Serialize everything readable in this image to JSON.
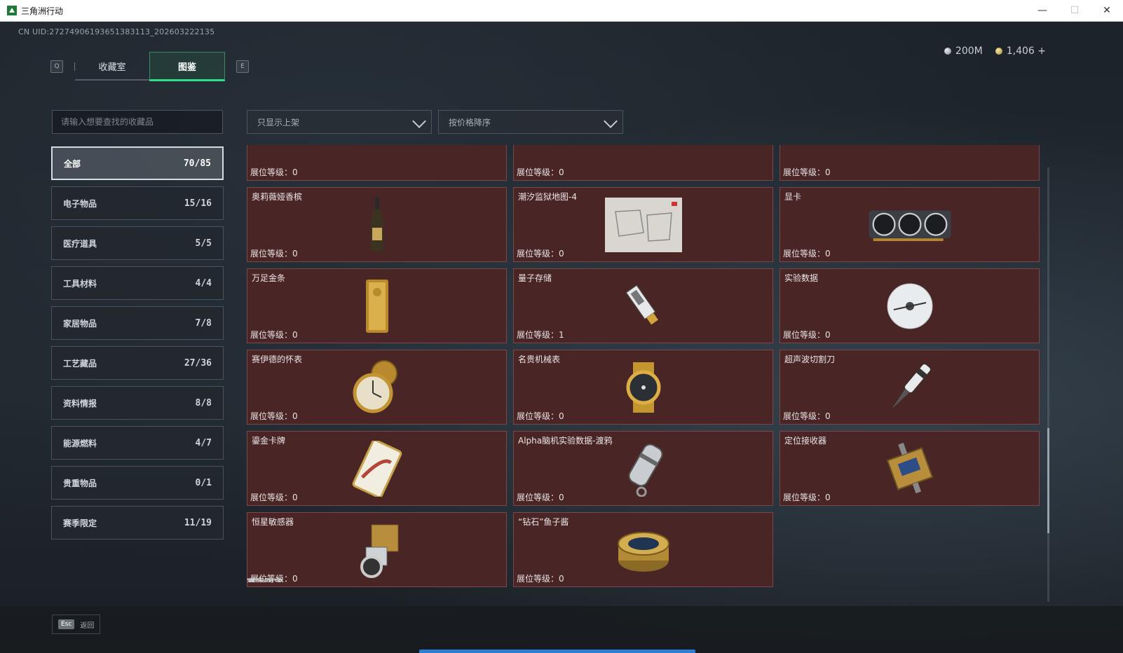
{
  "window": {
    "title": "三角洲行动",
    "minimize": "—",
    "maximize": "☐",
    "close": "✕"
  },
  "uid": "CN UID:2727490619365138311​3_202603222135",
  "tabs": {
    "left_key": "Q",
    "right_key": "E",
    "items": [
      {
        "label": "收藏室"
      },
      {
        "label": "图鉴"
      }
    ]
  },
  "currency": {
    "silver": "200M",
    "gold": "1,406 +"
  },
  "search": {
    "placeholder": "请输入想要查找的收藏品"
  },
  "filters": {
    "shelf": "只显示上架",
    "sort": "按价格降序"
  },
  "categories": [
    {
      "label": "全部",
      "count": "70/85"
    },
    {
      "label": "电子物品",
      "count": "15/16"
    },
    {
      "label": "医疗道具",
      "count": "5/5"
    },
    {
      "label": "工具材料",
      "count": "4/4"
    },
    {
      "label": "家居物品",
      "count": "7/8"
    },
    {
      "label": "工艺藏品",
      "count": "27/36"
    },
    {
      "label": "资料情报",
      "count": "8/8"
    },
    {
      "label": "能源燃料",
      "count": "4/7"
    },
    {
      "label": "贵重物品",
      "count": "0/1"
    },
    {
      "label": "赛季限定",
      "count": "11/19"
    }
  ],
  "items": [
    {
      "name": "",
      "level": "展位等级：0",
      "icon": "none"
    },
    {
      "name": "",
      "level": "展位等级：0",
      "icon": "none"
    },
    {
      "name": "",
      "level": "展位等级：0",
      "icon": "none"
    },
    {
      "name": "奥莉薇娅香槟",
      "level": "展位等级：0",
      "icon": "champagne-bottle-icon"
    },
    {
      "name": "潮汐监狱地图-4",
      "level": "展位等级：0",
      "icon": "map-icon"
    },
    {
      "name": "显卡",
      "level": "展位等级：0",
      "icon": "graphics-card-icon"
    },
    {
      "name": "万足金条",
      "level": "展位等级：0",
      "icon": "gold-bar-icon"
    },
    {
      "name": "量子存储",
      "level": "展位等级：1",
      "icon": "usb-drive-icon"
    },
    {
      "name": "实验数据",
      "level": "展位等级：0",
      "icon": "disc-icon"
    },
    {
      "name": "赛伊德的怀表",
      "level": "展位等级：0",
      "icon": "pocket-watch-icon"
    },
    {
      "name": "名贵机械表",
      "level": "展位等级：0",
      "icon": "wristwatch-icon"
    },
    {
      "name": "超声波切割刀",
      "level": "展位等级：0",
      "icon": "cutting-knife-icon"
    },
    {
      "name": "鎏金卡牌",
      "level": "展位等级：0",
      "icon": "card-icon"
    },
    {
      "name": "Alpha脑机实验数据-渡鸦",
      "level": "展位等级：0",
      "icon": "data-canister-icon"
    },
    {
      "name": "定位接收器",
      "level": "展位等级：0",
      "icon": "receiver-icon"
    },
    {
      "name": "恒星敏感器",
      "level": "展位等级：0",
      "icon": "star-sensor-icon"
    },
    {
      "name": "“钻石”鱼子酱",
      "level": "展位等级：0",
      "icon": "caviar-tin-icon"
    }
  ],
  "section_next": "赛季限定",
  "footer": {
    "esc_key": "Esc",
    "back_label": "返回"
  },
  "colors": {
    "accent": "#2fe08a",
    "card_bg": "#4a2526",
    "progress": "#2a7fd4"
  }
}
